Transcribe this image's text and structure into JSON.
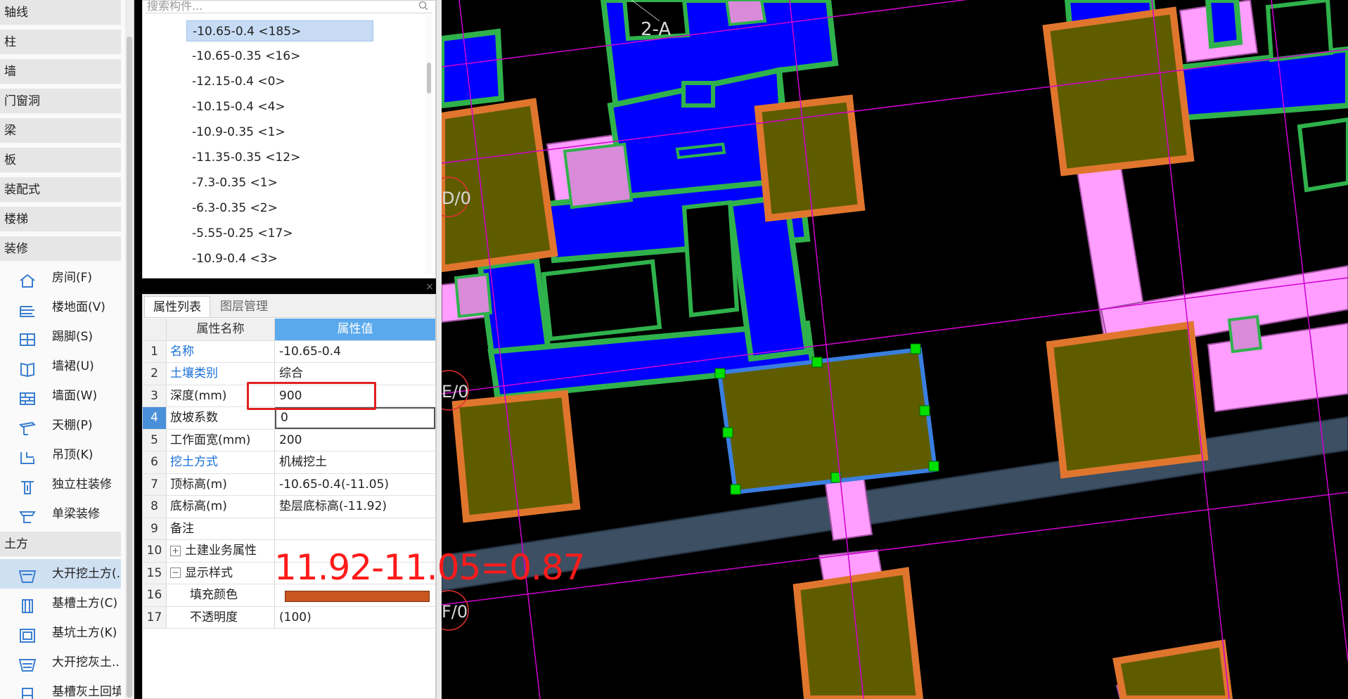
{
  "sidebar": {
    "categories": [
      "轴线",
      "柱",
      "墙",
      "门窗洞",
      "梁",
      "板",
      "装配式",
      "楼梯",
      "装修"
    ],
    "decoration_items": [
      {
        "label": "房间(F)",
        "icon": "room-icon"
      },
      {
        "label": "楼地面(V)",
        "icon": "floor-icon"
      },
      {
        "label": "踢脚(S)",
        "icon": "skirting-icon"
      },
      {
        "label": "墙裙(U)",
        "icon": "dado-icon"
      },
      {
        "label": "墙面(W)",
        "icon": "wall-surface-icon"
      },
      {
        "label": "天棚(P)",
        "icon": "ceiling-icon"
      },
      {
        "label": "吊顶(K)",
        "icon": "suspended-ceiling-icon"
      },
      {
        "label": "独立柱装修",
        "icon": "column-decor-icon"
      },
      {
        "label": "单梁装修",
        "icon": "beam-decor-icon"
      }
    ],
    "earthwork_category": "土方",
    "earthwork_items": [
      {
        "label": "大开挖土方(..",
        "icon": "excavation-icon"
      },
      {
        "label": "基槽土方(C)",
        "icon": "trench-icon"
      },
      {
        "label": "基坑土方(K)",
        "icon": "pit-icon"
      },
      {
        "label": "大开挖灰土..",
        "icon": "lime-soil-icon"
      },
      {
        "label": "基槽灰土回填",
        "icon": "trench-backfill-icon"
      }
    ]
  },
  "component_list": {
    "search_placeholder": "搜索构件...",
    "items": [
      "-10.65-0.4 <185>",
      "-10.65-0.35 <16>",
      "-12.15-0.4 <0>",
      "-10.15-0.4 <4>",
      "-10.9-0.35 <1>",
      "-11.35-0.35 <12>",
      "-7.3-0.35 <1>",
      "-6.3-0.35 <2>",
      "-5.55-0.25 <17>",
      "-10.9-0.4 <3>"
    ],
    "selected_index": 0
  },
  "properties": {
    "close_symbol": "×",
    "tabs": [
      "属性列表",
      "图层管理"
    ],
    "header": {
      "name": "属性名称",
      "value": "属性值"
    },
    "rows": [
      {
        "no": "1",
        "name": "名称",
        "value": "-10.65-0.4"
      },
      {
        "no": "2",
        "name": "土壤类别",
        "value": "综合"
      },
      {
        "no": "3",
        "name": "深度(mm)",
        "value": "900"
      },
      {
        "no": "4",
        "name": "放坡系数",
        "value": "0"
      },
      {
        "no": "5",
        "name": "工作面宽(mm)",
        "value": "200"
      },
      {
        "no": "6",
        "name": "挖土方式",
        "value": "机械挖土"
      },
      {
        "no": "7",
        "name": "顶标高(m)",
        "value": "-10.65-0.4(-11.05)"
      },
      {
        "no": "8",
        "name": "底标高(m)",
        "value": "垫层底标高(-11.92)"
      },
      {
        "no": "9",
        "name": "备注",
        "value": ""
      },
      {
        "no": "10",
        "name": "土建业务属性",
        "value": "",
        "toggle": "+"
      },
      {
        "no": "15",
        "name": "显示样式",
        "value": "",
        "toggle": "−"
      },
      {
        "no": "16",
        "name": "填充颜色",
        "value": ""
      },
      {
        "no": "17",
        "name": "不透明度",
        "value": "(100)"
      }
    ],
    "fill_color": "#c8561f"
  },
  "annotation": "11.92-11.05=0.87",
  "canvas": {
    "axis_labels": [
      "2-A",
      "D/0",
      "E/0",
      "F/0"
    ],
    "colors": {
      "foundation": "#5f5c00",
      "excavation_border": "#e0762e",
      "wall": "#0000ff",
      "wall_border": "#2fb24c",
      "beam": "#ff9eff",
      "road": "#3c4f63",
      "axis_line": "#d000d0",
      "selection": "#3a7fe0",
      "grip": "#00e000"
    }
  }
}
